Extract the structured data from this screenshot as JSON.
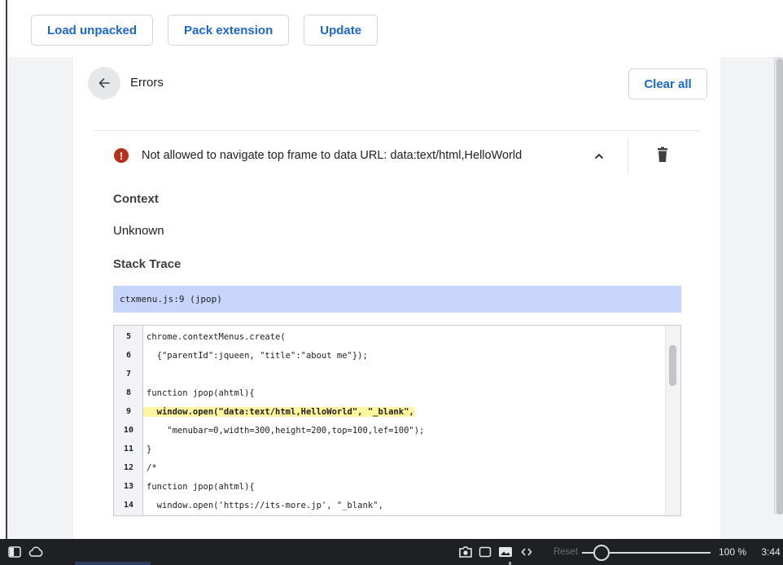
{
  "toolbar": {
    "load_unpacked": "Load unpacked",
    "pack_extension": "Pack extension",
    "update": "Update"
  },
  "header": {
    "title": "Errors",
    "clear_all": "Clear all"
  },
  "error": {
    "message": "Not allowed to navigate top frame to data URL: data:text/html,HelloWorld",
    "icon": "error-icon",
    "expand_icon": "chevron-up-icon",
    "delete_icon": "trash-icon"
  },
  "details": {
    "context_label": "Context",
    "context_value": "Unknown",
    "stack_trace_label": "Stack Trace",
    "stack_frame": "ctxmenu.js:9 (jpop)"
  },
  "code": {
    "lines": [
      {
        "num": "5",
        "text": "chrome.contextMenus.create(",
        "highlight": false
      },
      {
        "num": "6",
        "text": "  {\"parentId\":jqueen, \"title\":\"about me\"});",
        "highlight": false
      },
      {
        "num": "7",
        "text": "",
        "highlight": false
      },
      {
        "num": "8",
        "text": "function jpop(ahtml){",
        "highlight": false
      },
      {
        "num": "9",
        "text": "  window.open(\"data:text/html,HelloWorld\", \"_blank\",",
        "highlight": true
      },
      {
        "num": "10",
        "text": "    \"menubar=0,width=300,height=200,top=100,lef=100\");",
        "highlight": false
      },
      {
        "num": "11",
        "text": "}",
        "highlight": false
      },
      {
        "num": "12",
        "text": "/*",
        "highlight": false
      },
      {
        "num": "13",
        "text": "function jpop(ahtml){",
        "highlight": false
      },
      {
        "num": "14",
        "text": "  window.open('https://its-more.jp', \"_blank\",",
        "highlight": false
      }
    ]
  },
  "taskbar": {
    "reset_label": "Reset",
    "zoom_level": "100 %",
    "zoom_fraction": 0.15,
    "clock": "3:44"
  },
  "colors": {
    "accent": "#1a66d2",
    "error": "#b9301c",
    "trace_highlight": "#c6d5f9",
    "code_highlight": "#fff59d"
  }
}
